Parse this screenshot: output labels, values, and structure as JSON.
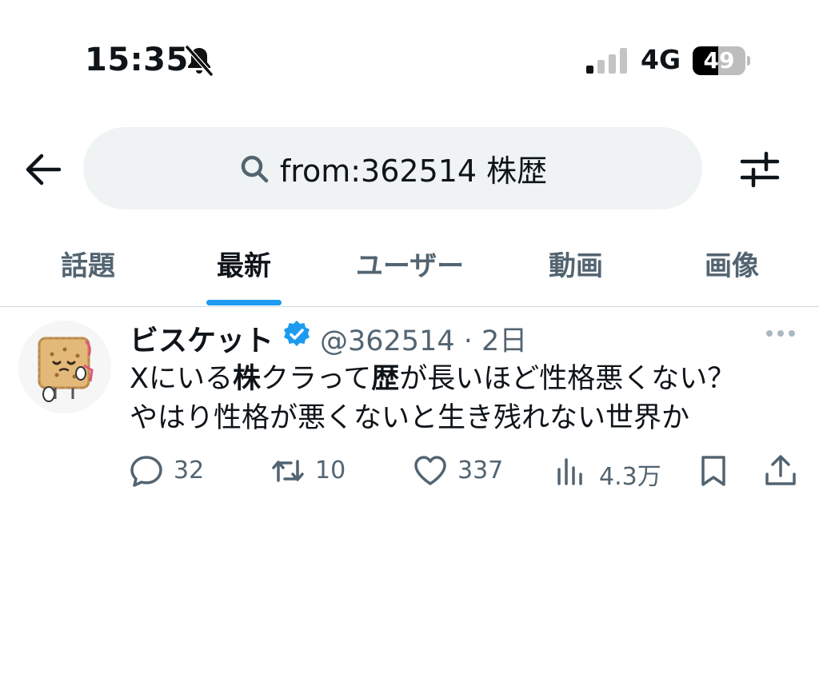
{
  "status_bar": {
    "time": "15:35",
    "network": "4G",
    "battery_level": "49",
    "battery_fraction": 0.49,
    "icons": [
      "bell-slash-icon",
      "signal-bars-icon",
      "battery-icon"
    ]
  },
  "search": {
    "query": "from:362514 株歴",
    "icons": [
      "back-arrow-icon",
      "search-icon",
      "filter-sliders-icon"
    ]
  },
  "tabs": {
    "items": [
      {
        "label": "話題"
      },
      {
        "label": "最新",
        "active": true
      },
      {
        "label": "ユーザー"
      },
      {
        "label": "動画"
      },
      {
        "label": "画像"
      }
    ],
    "accent": "#1d9bf0"
  },
  "tweet": {
    "display_name": "ビスケット",
    "verified": true,
    "handle": "@362514",
    "separator": "·",
    "time_ago": "2日",
    "lines": [
      [
        {
          "text": "Xにいる",
          "bold": false
        },
        {
          "text": "株",
          "bold": true
        },
        {
          "text": "クラって",
          "bold": false
        },
        {
          "text": "歴",
          "bold": true
        },
        {
          "text": "が長いほど性格悪くない？",
          "bold": false
        }
      ],
      [
        {
          "text": "やはり性格が悪くないと生き残れない世界か",
          "bold": false
        }
      ]
    ],
    "actions": {
      "replies": "32",
      "retweets": "10",
      "likes": "337",
      "views": "4.3万"
    },
    "action_icons": [
      "reply-icon",
      "retweet-icon",
      "like-icon",
      "views-icon",
      "bookmark-icon",
      "share-icon"
    ]
  },
  "colors": {
    "text": "#0f1419",
    "secondary": "#536471",
    "search_bg": "#eff3f4",
    "divider": "#cfd9de",
    "verified": "#1d9bf0"
  }
}
